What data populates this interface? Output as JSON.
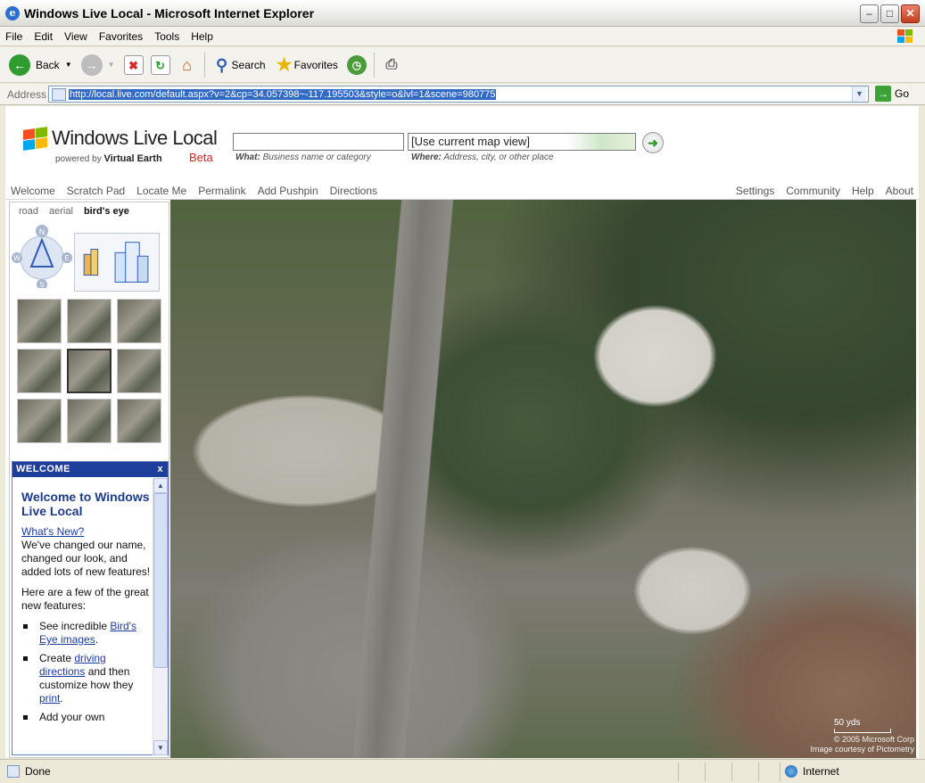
{
  "window": {
    "title": "Windows Live Local - Microsoft Internet Explorer",
    "min_symbol": "–",
    "max_symbol": "□",
    "close_symbol": "✕"
  },
  "menu": [
    "File",
    "Edit",
    "View",
    "Favorites",
    "Tools",
    "Help"
  ],
  "toolbar": {
    "back_label": "Back",
    "search_label": "Search",
    "favorites_label": "Favorites"
  },
  "address": {
    "label": "Address",
    "url": "http://local.live.com/default.aspx?v=2&cp=34.057398~-117.195503&style=o&lvl=1&scene=980775",
    "go_label": "Go"
  },
  "brand": {
    "logo_text": "Windows Live Local",
    "powered_by": "powered by",
    "engine": "Virtual Earth",
    "beta": "Beta",
    "accent": "#d42020"
  },
  "search": {
    "what_value": "",
    "where_value": "[Use current map view]",
    "what_hint_label": "What:",
    "what_hint": "Business name or category",
    "where_hint_label": "Where:",
    "where_hint": "Address, city, or other place"
  },
  "nav_left": [
    "Welcome",
    "Scratch Pad",
    "Locate Me",
    "Permalink",
    "Add Pushpin",
    "Directions"
  ],
  "nav_right": [
    "Settings",
    "Community",
    "Help",
    "About"
  ],
  "view_tabs": {
    "road": "road",
    "aerial": "aerial",
    "birds_eye": "bird's eye",
    "active": "bird's eye"
  },
  "compass_labels": {
    "n": "N",
    "s": "S",
    "e": "E",
    "w": "W"
  },
  "welcome": {
    "panel_title": "WELCOME",
    "close": "x",
    "heading": "Welcome to Windows Live Local",
    "whats_new_link": "What's New?",
    "intro": "We've changed our name, changed our look, and added lots of new features!",
    "features_intro": "Here are a few of the great new features:",
    "bullet1_pre": "See incredible ",
    "bullet1_link": "Bird's Eye images",
    "bullet1_post": ".",
    "bullet2_pre": "Create ",
    "bullet2_link": "driving directions",
    "bullet2_mid": " and then customize how they ",
    "bullet2_link2": "print",
    "bullet2_post": ".",
    "bullet3": "Add your own"
  },
  "map": {
    "scale_label": "50 yds",
    "copyright": "© 2005 Microsoft Corp",
    "imagery": "Image courtesy of Pictometry"
  },
  "status": {
    "text": "Done",
    "zone": "Internet"
  }
}
